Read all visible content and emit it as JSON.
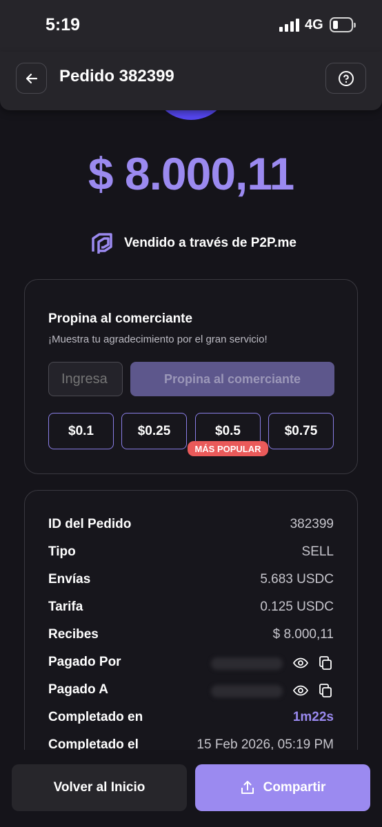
{
  "status_bar": {
    "time": "5:19",
    "network": "4G"
  },
  "header": {
    "title": "Pedido 382399",
    "back_icon": "arrow-left-icon",
    "help_icon": "question-circle-icon"
  },
  "summary": {
    "amount": "$ 8.000,11",
    "via_text": "Vendido a través de P2P.me",
    "logo_icon": "p2p-logo-icon",
    "accent_color": "#9b8af0"
  },
  "tip": {
    "title": "Propina al comerciante",
    "subtitle": "¡Muestra tu agradecimiento por el gran servicio!",
    "input_placeholder": "Ingresa",
    "submit_label": "Propina al comerciante",
    "options": [
      "$0.1",
      "$0.25",
      "$0.5",
      "$0.75"
    ],
    "popular_badge": "MÁS POPULAR"
  },
  "details": {
    "rows": [
      {
        "label": "ID del Pedido",
        "value": "382399"
      },
      {
        "label": "Tipo",
        "value": "SELL"
      },
      {
        "label": "Envías",
        "value": "5.683 USDC"
      },
      {
        "label": "Tarifa",
        "value": "0.125 USDC"
      },
      {
        "label": "Recibes",
        "value": "$ 8.000,11"
      },
      {
        "label": "Pagado Por",
        "value": ""
      },
      {
        "label": "Pagado A",
        "value": ""
      },
      {
        "label": "Completado en",
        "value": "1m22s"
      },
      {
        "label": "Completado el",
        "value": "15 Feb 2026, 05:19 PM"
      }
    ]
  },
  "actions": {
    "home_label": "Volver al Inicio",
    "share_label": "Compartir",
    "share_icon": "share-icon"
  }
}
